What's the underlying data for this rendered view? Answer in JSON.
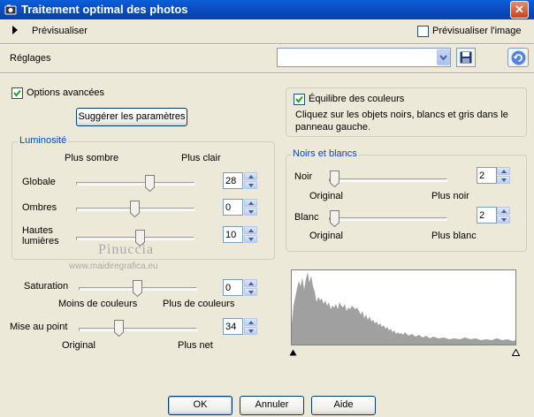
{
  "window": {
    "title": "Traitement optimal des photos",
    "close_glyph": "✕"
  },
  "top": {
    "preview_label": "Prévisualiser",
    "preview_image_label": "Prévisualiser l'image",
    "preview_image_checked": false
  },
  "settings": {
    "label": "Réglages",
    "preset_value": ""
  },
  "advanced": {
    "label": "Options avancées",
    "checked": true
  },
  "suggest_button": "Suggérer les paramètres",
  "brightness": {
    "legend": "Luminosité",
    "left_label": "Plus sombre",
    "right_label": "Plus clair",
    "rows": [
      {
        "label": "Globale",
        "value": "28"
      },
      {
        "label": "Ombres",
        "value": "0"
      },
      {
        "label_line1": "Hautes",
        "label_line2": "lumières",
        "value": "10"
      }
    ]
  },
  "saturation": {
    "label": "Saturation",
    "value": "0",
    "left_label": "Moins de couleurs",
    "right_label": "Plus de couleurs"
  },
  "focus": {
    "label": "Mise au point",
    "value": "34",
    "left_label": "Original",
    "right_label": "Plus net"
  },
  "color_balance": {
    "label": "Équilibre des couleurs",
    "checked": true,
    "hint_line1": "Cliquez sur les objets noirs, blancs et gris dans le",
    "hint_line2": "panneau gauche."
  },
  "black_white": {
    "legend": "Noirs et blancs",
    "black": {
      "label": "Noir",
      "value": "2",
      "left_label": "Original",
      "right_label": "Plus noir"
    },
    "white": {
      "label": "Blanc",
      "value": "2",
      "left_label": "Original",
      "right_label": "Plus blanc"
    }
  },
  "watermark": {
    "name": "Pinuccia",
    "site": "www.maidiregrafica.eu"
  },
  "buttons": {
    "ok": "OK",
    "cancel": "Annuler",
    "help": "Aide"
  },
  "colors": {
    "titlebar": "#0A5FD8",
    "accent": "#0046D5",
    "histogram": "#A0A0A0"
  }
}
